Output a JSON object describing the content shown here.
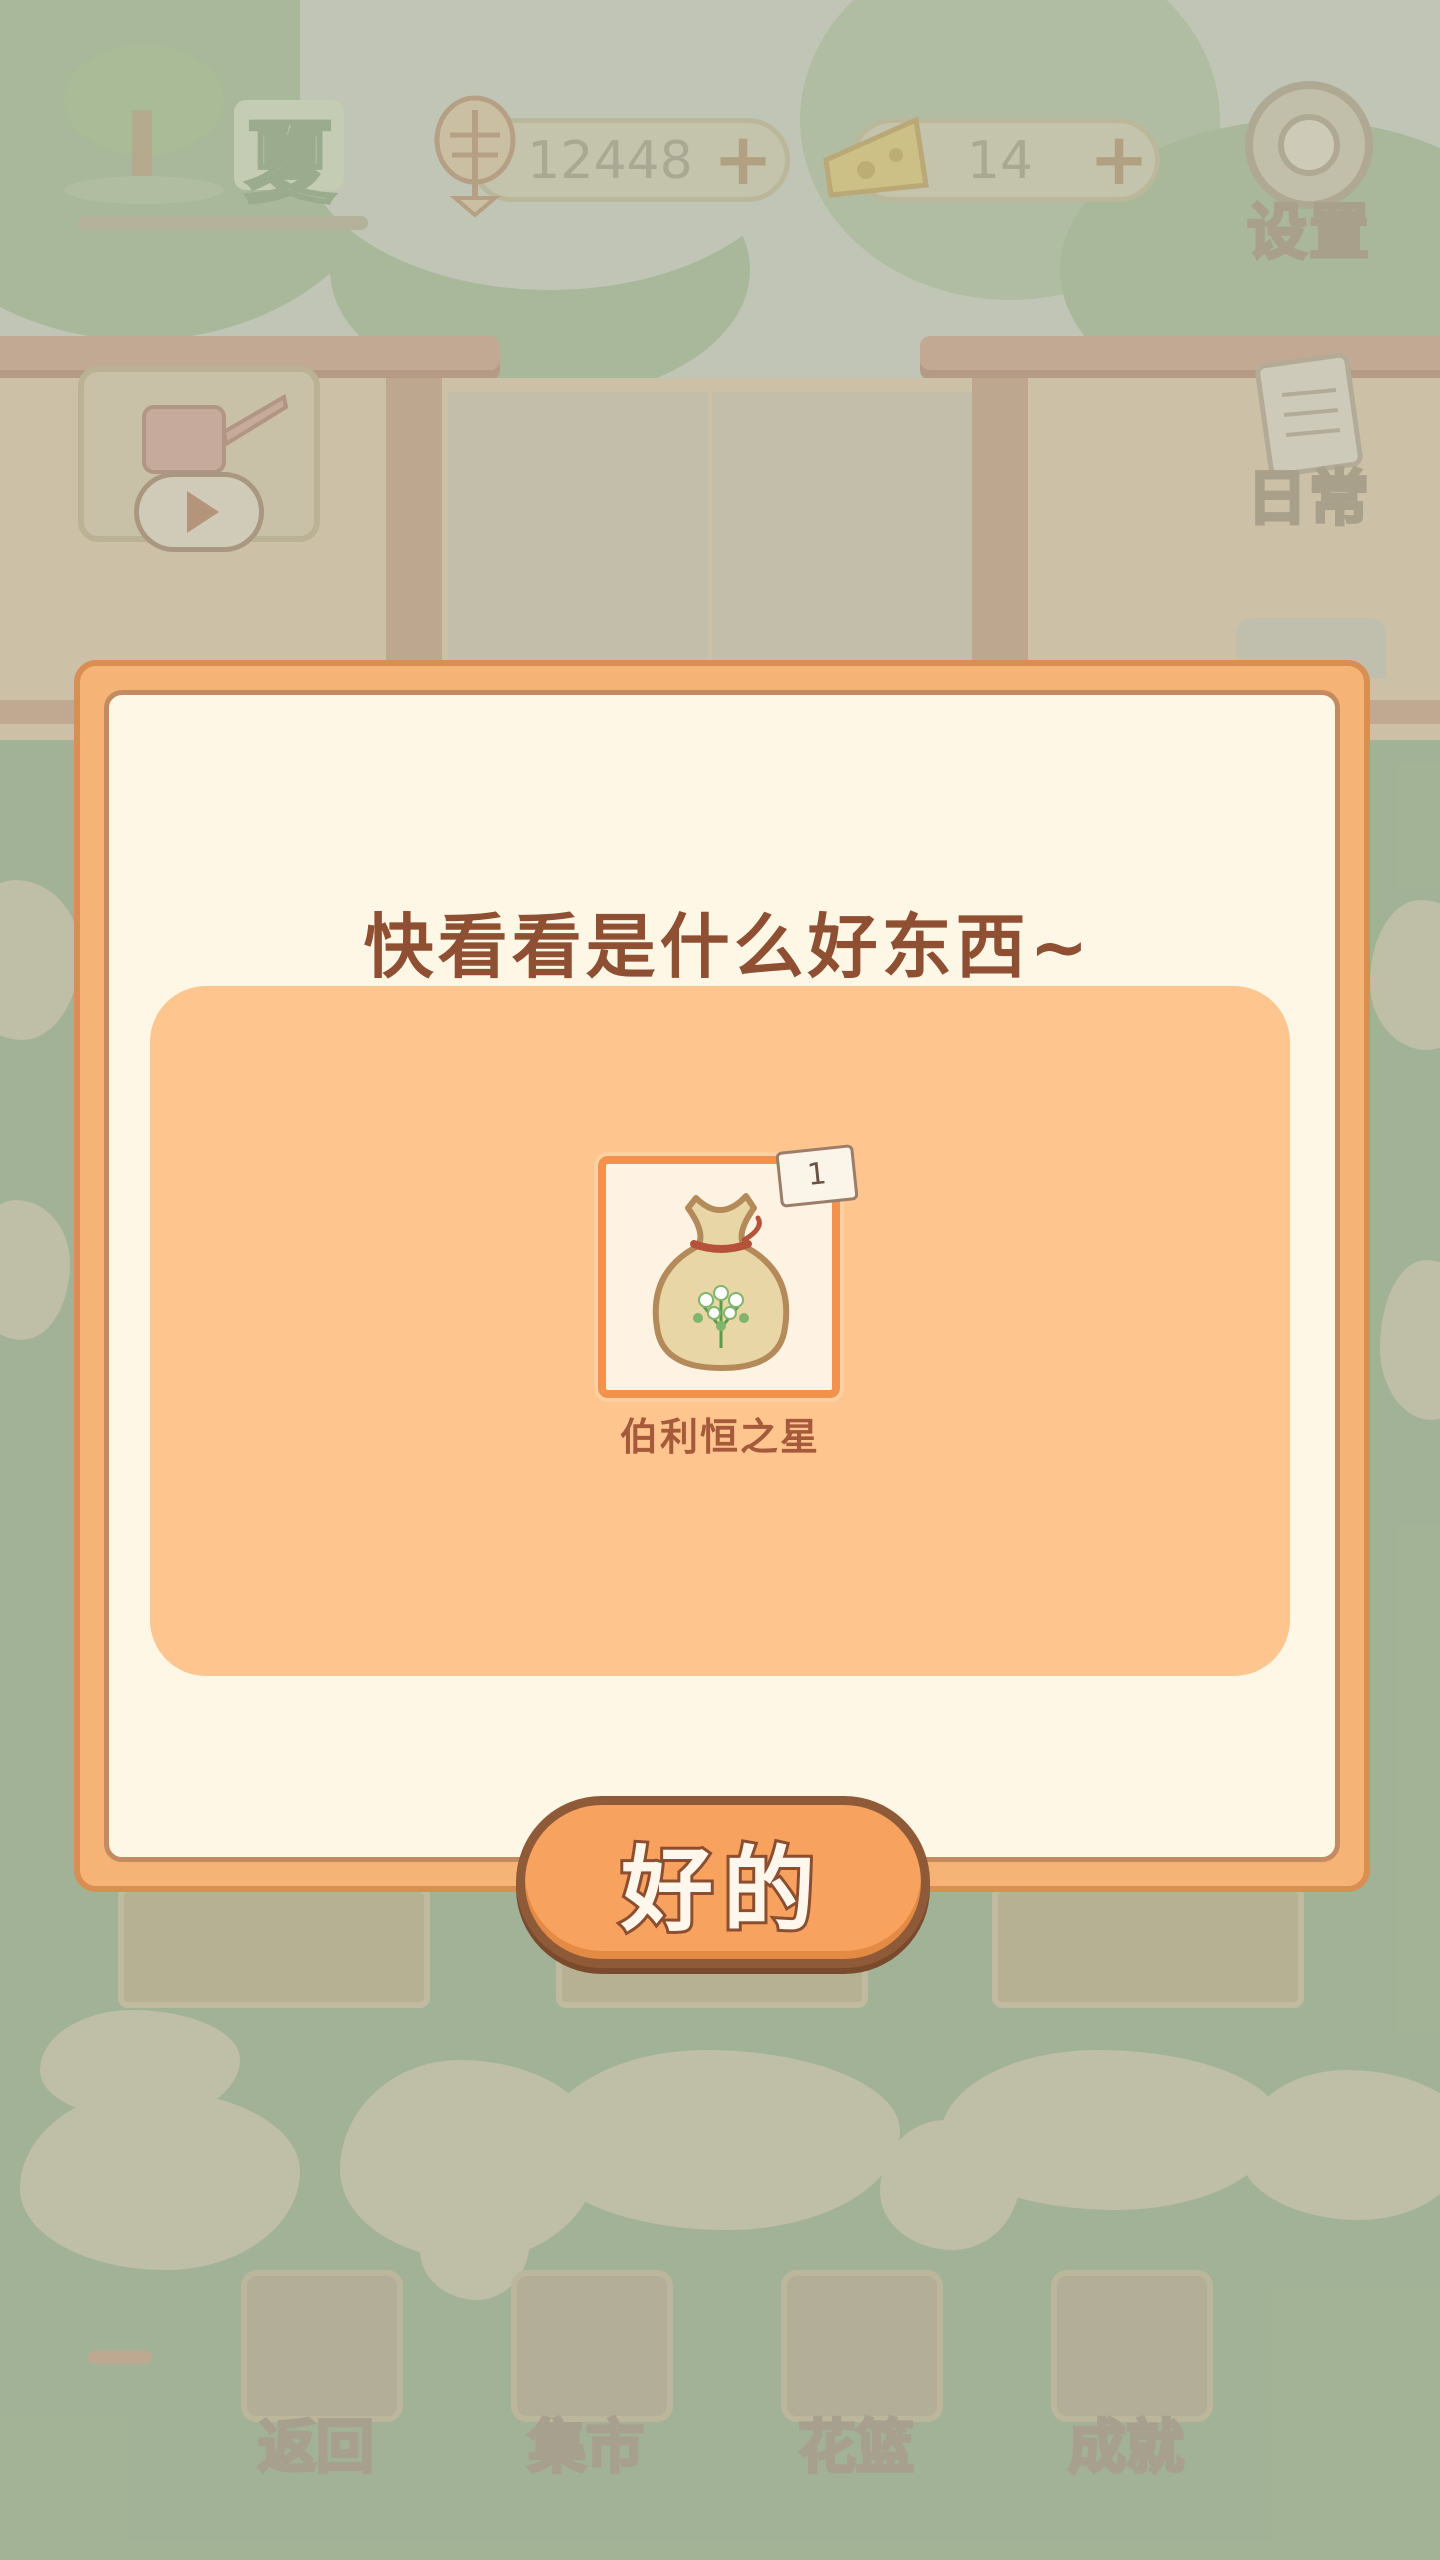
{
  "hud": {
    "season_label": "夏",
    "fish_count": "12448",
    "cheese_count": "14",
    "plus_symbol": "+",
    "settings_label": "设置",
    "daily_label": "日常"
  },
  "bottom_nav": {
    "items": [
      {
        "label": "返回",
        "icon": "window-icon"
      },
      {
        "label": "集市",
        "icon": "market-stall-icon"
      },
      {
        "label": "花篮",
        "icon": "flower-basket-icon"
      },
      {
        "label": "成就",
        "icon": "trophy-icon"
      }
    ]
  },
  "dialog": {
    "title": "快看看是什么好东西~",
    "reward": {
      "name": "伯利恒之星",
      "count": "1",
      "icon": "seed-bag-icon"
    },
    "confirm_label": "好的"
  },
  "colors": {
    "dialog_border": "#f5b476",
    "dialog_bg": "#fef7e6",
    "panel_bg": "#ffc58e",
    "title_text": "#8e4f33",
    "button_fill": "#f7a25e",
    "button_outline": "#8f5a37"
  }
}
